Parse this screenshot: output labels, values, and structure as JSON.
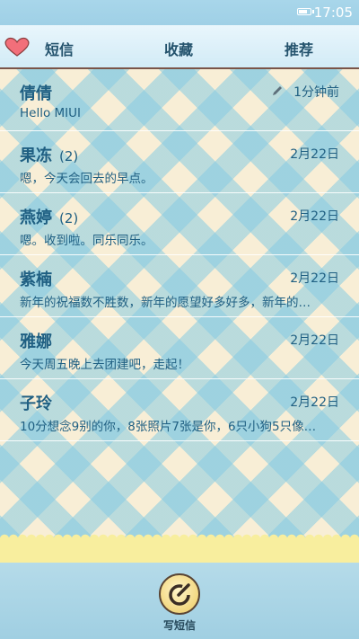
{
  "status_bar": {
    "time": "17:05",
    "battery_level": 0.8
  },
  "tabs": [
    {
      "label": "短信",
      "active": true
    },
    {
      "label": "收藏",
      "active": false
    },
    {
      "label": "推荐",
      "active": false
    }
  ],
  "conversations": [
    {
      "name": "倩倩",
      "count": "",
      "time": "1分钟前",
      "draft": true,
      "snippet": "Hello MIUI"
    },
    {
      "name": "果冻",
      "count": "(2)",
      "time": "2月22日",
      "draft": false,
      "snippet": "嗯，今天会回去的早点。"
    },
    {
      "name": "燕婷",
      "count": "(2)",
      "time": "2月22日",
      "draft": false,
      "snippet": "嗯。收到啦。同乐同乐。"
    },
    {
      "name": "紫楠",
      "count": "",
      "time": "2月22日",
      "draft": false,
      "snippet": "新年的祝福数不胜数，新年的愿望好多好多，新年的…"
    },
    {
      "name": "雅娜",
      "count": "",
      "time": "2月22日",
      "draft": false,
      "snippet": "今天周五晚上去团建吧，走起！"
    },
    {
      "name": "子玲",
      "count": "",
      "time": "2月22日",
      "draft": false,
      "snippet": "10分想念9别的你，8张照片7张是你，6只小狗5只像…"
    }
  ],
  "compose": {
    "label": "写短信"
  },
  "colors": {
    "accent": "#1f5f82",
    "tab_text": "#23526c",
    "bar_blue": "#a0cfe2"
  },
  "icons": [
    "heart-icon",
    "pencil-icon",
    "compose-icon",
    "battery-icon"
  ]
}
